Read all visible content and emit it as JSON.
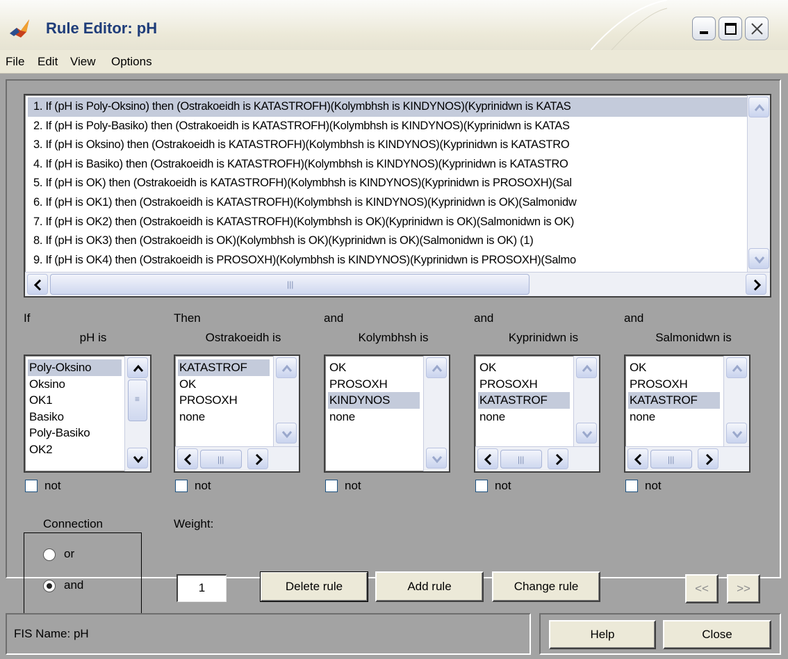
{
  "window": {
    "title": "Rule Editor: pH",
    "icon": "matlab-icon"
  },
  "menu": [
    "File",
    "Edit",
    "View",
    "Options"
  ],
  "rules": [
    "1. If (pH is Poly-Oksino) then (Ostrakoeidh is KATASTROFH)(Kolymbhsh is KINDYNOS)(Kyprinidwn is KATAS",
    "2. If (pH is Poly-Basiko) then (Ostrakoeidh is KATASTROFH)(Kolymbhsh is KINDYNOS)(Kyprinidwn is KATAS",
    "3. If (pH is Oksino) then (Ostrakoeidh is KATASTROFH)(Kolymbhsh is KINDYNOS)(Kyprinidwn is KATASTRO",
    "4. If (pH is Basiko) then (Ostrakoeidh is KATASTROFH)(Kolymbhsh is KINDYNOS)(Kyprinidwn is KATASTRO",
    "5. If (pH is OK) then (Ostrakoeidh is KATASTROFH)(Kolymbhsh is KINDYNOS)(Kyprinidwn is PROSOXH)(Sal",
    "6. If (pH is OK1) then (Ostrakoeidh is KATASTROFH)(Kolymbhsh is KINDYNOS)(Kyprinidwn is OK)(Salmonidw",
    "7. If (pH is OK2) then (Ostrakoeidh is KATASTROFH)(Kolymbhsh is OK)(Kyprinidwn is OK)(Salmonidwn is OK)",
    "8. If (pH is OK3) then (Ostrakoeidh is OK)(Kolymbhsh is OK)(Kyprinidwn is OK)(Salmonidwn is OK) (1)",
    "9. If (pH is OK4) then (Ostrakoeidh is PROSOXH)(Kolymbhsh is KINDYNOS)(Kyprinidwn is PROSOXH)(Salmo"
  ],
  "editor": {
    "if_label": "If",
    "then_label": "Then",
    "and_label": "and",
    "not_label": "not",
    "columns": [
      {
        "name": "pH is",
        "items": [
          "Poly-Oksino",
          "Oksino",
          "OK1",
          "Basiko",
          "Poly-Basiko",
          "OK2"
        ]
      },
      {
        "name": "Ostrakoeidh is",
        "items": [
          "KATASTROF",
          "OK",
          "PROSOXH",
          "none"
        ]
      },
      {
        "name": "Kolymbhsh is",
        "items": [
          "OK",
          "PROSOXH",
          "KINDYNOS",
          "none"
        ]
      },
      {
        "name": "Kyprinidwn is",
        "items": [
          "OK",
          "PROSOXH",
          "KATASTROF",
          "none"
        ]
      },
      {
        "name": "Salmonidwn is",
        "items": [
          "OK",
          "PROSOXH",
          "KATASTROF",
          "none"
        ]
      }
    ]
  },
  "connection": {
    "title": "Connection",
    "options": [
      "or",
      "and"
    ],
    "selected": "and"
  },
  "weight": {
    "label": "Weight:",
    "value": "1"
  },
  "buttons": {
    "delete": "Delete rule",
    "add": "Add rule",
    "change": "Change rule",
    "prev": "<<",
    "next": ">>",
    "help": "Help",
    "close": "Close"
  },
  "status": "FIS Name: pH"
}
